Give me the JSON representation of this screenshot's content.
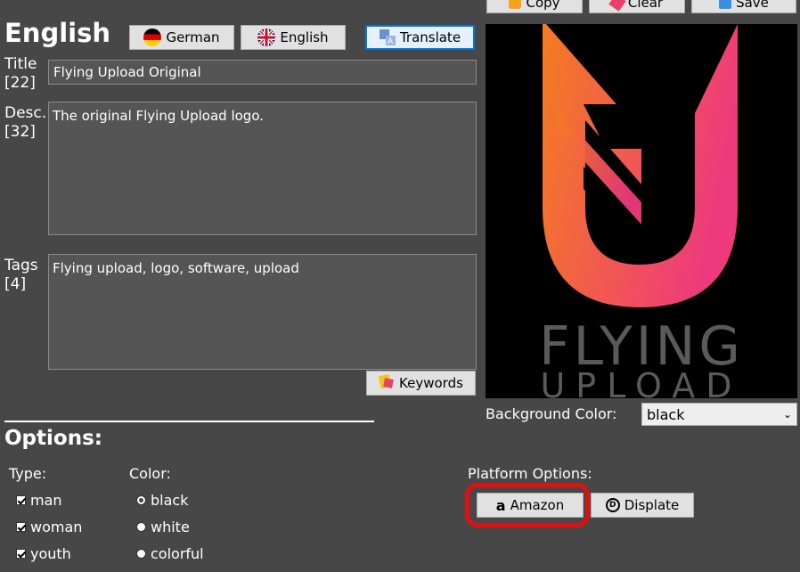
{
  "colors": {
    "background": "#474747",
    "field_bg": "#555555",
    "button_bg": "#e1e1e1",
    "focus_blue": "#0078d7",
    "annotation_red": "#e01010",
    "logo_orange": "#f47c20",
    "logo_pink": "#ee3a7c"
  },
  "top_buttons": {
    "copy": "Copy",
    "clear": "Clear",
    "save": "Save"
  },
  "language": {
    "heading": "English",
    "german_button": "German",
    "english_button": "English",
    "translate_button": "Translate"
  },
  "fields": {
    "title_label": "Title",
    "title_count": "[22]",
    "title_value": "Flying Upload Original",
    "desc_label": "Desc.",
    "desc_count": "[32]",
    "desc_value": "The original Flying Upload logo.",
    "tags_label": "Tags",
    "tags_count": "[4]",
    "tags_value": "Flying upload, logo, software, upload",
    "keywords_button": "Keywords"
  },
  "preview": {
    "logo_line1": "FLYING",
    "logo_line2": "UPLOAD",
    "bg_color_label": "Background Color:",
    "bg_color_value": "black"
  },
  "options": {
    "heading": "Options:",
    "type_label": "Type:",
    "type_items": [
      "man",
      "woman",
      "youth"
    ],
    "color_label": "Color:",
    "color_items": [
      "black",
      "white",
      "colorful"
    ],
    "color_selected": "black",
    "platform_label": "Platform Options:",
    "amazon_button": "Amazon",
    "displate_button": "Displate"
  }
}
